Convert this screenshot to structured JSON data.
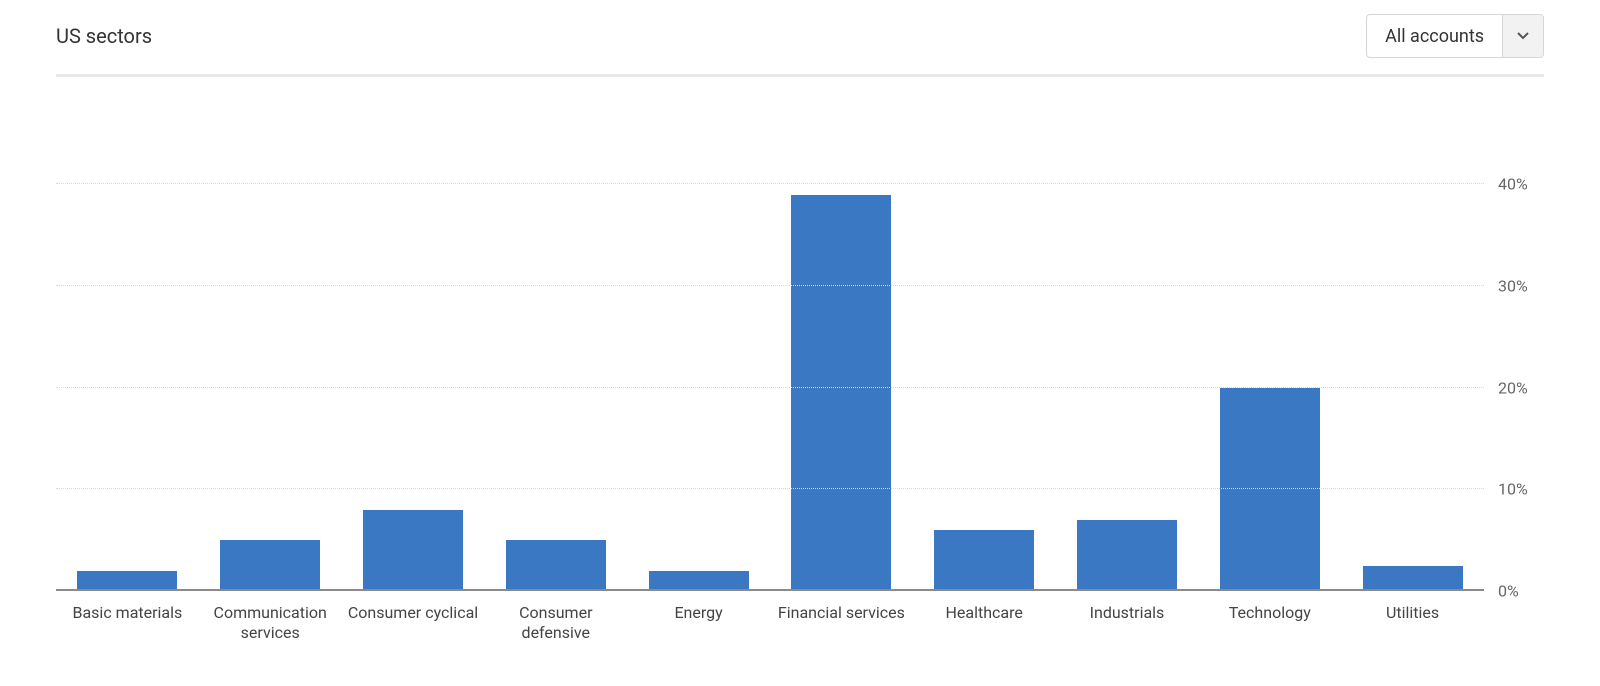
{
  "header": {
    "title": "US sectors",
    "account_selector": {
      "selected": "All accounts"
    }
  },
  "chart_data": {
    "type": "bar",
    "title": "US sectors",
    "xlabel": "",
    "ylabel": "",
    "ylim": [
      0,
      48
    ],
    "y_ticks": [
      0,
      10,
      20,
      30,
      40
    ],
    "y_tick_labels": [
      "0%",
      "10%",
      "20%",
      "30%",
      "40%"
    ],
    "categories": [
      "Basic materials",
      "Communication services",
      "Consumer cyclical",
      "Consumer defensive",
      "Energy",
      "Financial services",
      "Healthcare",
      "Industrials",
      "Technology",
      "Utilities"
    ],
    "values": [
      2,
      5,
      8,
      5,
      2,
      39,
      6,
      7,
      20,
      2.5
    ],
    "bar_color": "#3a78c4"
  }
}
